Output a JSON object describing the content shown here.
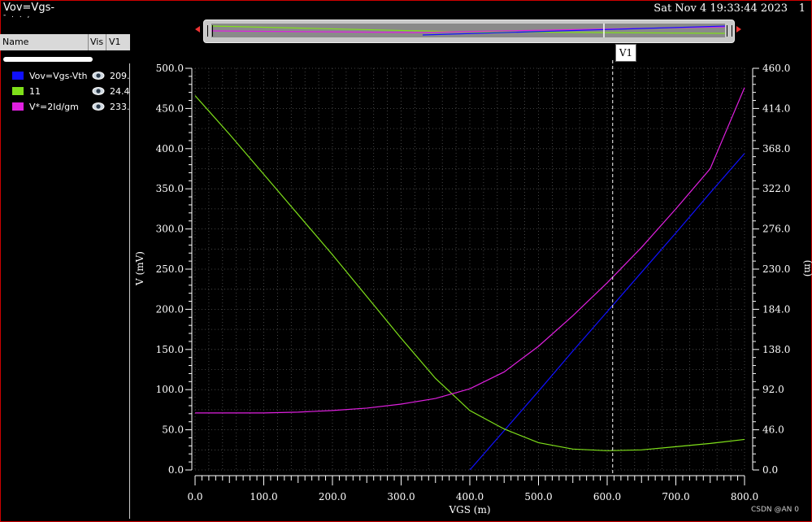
{
  "window": {
    "title": "Vov=Vgs-",
    "subtitle": "- . . ,",
    "timestamp": "Sat Nov 4 19:33:44 2023",
    "page": "1"
  },
  "legend": {
    "headers": {
      "name": "Name",
      "vis": "Vis",
      "value": "V1"
    },
    "items": [
      {
        "name": "Vov=Vgs-Vth",
        "color": "#1010ff",
        "value": "209.",
        "icon": "eye-icon"
      },
      {
        "name": "11",
        "color": "#7fe01a",
        "value": "24.4",
        "icon": "eye-icon"
      },
      {
        "name": "V*=2Id/gm",
        "color": "#e020e0",
        "value": "233.",
        "icon": "eye-icon"
      }
    ]
  },
  "cursor": {
    "label": "V1",
    "x": 608
  },
  "watermark": "CSDN @AN 0",
  "chart_data": {
    "type": "line",
    "xlabel": "VGS (m)",
    "ylabel_left": "V (mV)",
    "ylabel_right": "(m)",
    "xlim": [
      0,
      800
    ],
    "ylim_left": [
      0,
      500
    ],
    "ylim_right": [
      0,
      460
    ],
    "x_ticks": [
      "0.0",
      "100.0",
      "200.0",
      "300.0",
      "400.0",
      "500.0",
      "600.0",
      "700.0",
      "800.0"
    ],
    "y_left_ticks": [
      "0.0",
      "50.0",
      "100.0",
      "150.0",
      "200.0",
      "250.0",
      "300.0",
      "350.0",
      "400.0",
      "450.0",
      "500.0"
    ],
    "y_right_ticks": [
      "0.0",
      "46.0",
      "92.0",
      "138.0",
      "184.0",
      "230.0",
      "276.0",
      "322.0",
      "368.0",
      "414.0",
      "460.0"
    ],
    "grid": true,
    "series": [
      {
        "name": "Vov=Vgs-Vth",
        "color": "#1010ff",
        "axis": "left",
        "x": [
          400,
          450,
          500,
          550,
          600,
          650,
          700,
          750,
          800
        ],
        "y": [
          0,
          49,
          98,
          148,
          197,
          246,
          295,
          345,
          394
        ]
      },
      {
        "name": "11",
        "color": "#7fe01a",
        "axis": "left",
        "x": [
          0,
          50,
          100,
          150,
          200,
          250,
          300,
          350,
          400,
          450,
          500,
          550,
          600,
          650,
          700,
          750,
          800
        ],
        "y": [
          466,
          418,
          368,
          318,
          268,
          216,
          164,
          114,
          74,
          51,
          34,
          26,
          24,
          25,
          29,
          33,
          38
        ]
      },
      {
        "name": "V*=2Id/gm",
        "color": "#e020e0",
        "axis": "left",
        "x": [
          0,
          50,
          100,
          150,
          200,
          250,
          300,
          350,
          400,
          450,
          500,
          550,
          600,
          650,
          700,
          750,
          800
        ],
        "y": [
          71,
          71,
          71,
          72,
          74,
          77,
          82,
          89,
          101,
          122,
          154,
          192,
          233,
          277,
          325,
          375,
          476
        ]
      }
    ]
  }
}
